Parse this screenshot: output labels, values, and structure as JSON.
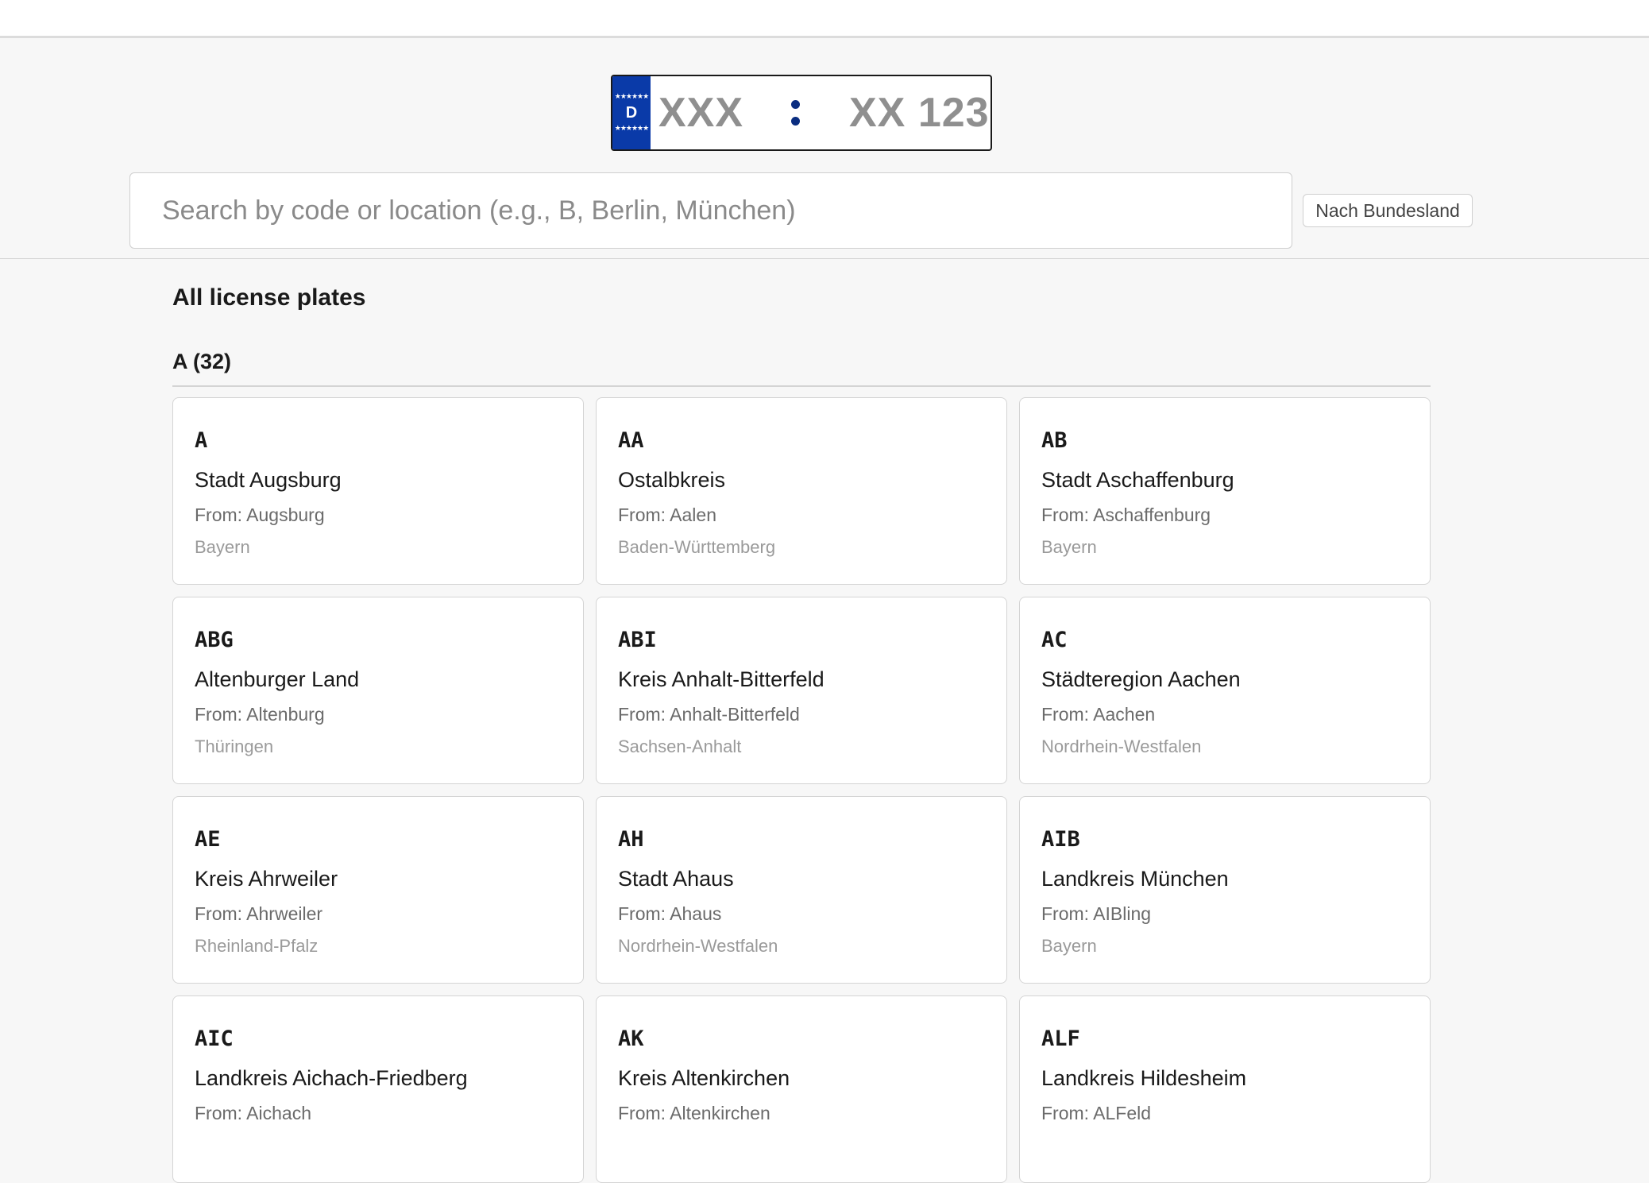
{
  "plate": {
    "eu_stars_top": "★★★★★★",
    "country": "D",
    "eu_stars_bottom": "★★★★★★",
    "left_placeholder": "XXX",
    "right_placeholder": "XX 123"
  },
  "search": {
    "placeholder": "Search by code or location (e.g., B, Berlin, München)",
    "value": ""
  },
  "filter_button": "Nach Bundesland",
  "page_title": "All license plates",
  "group": {
    "title": "A (32)",
    "cards": [
      {
        "code": "A",
        "name": "Stadt Augsburg",
        "from": "From: Augsburg",
        "state": "Bayern"
      },
      {
        "code": "AA",
        "name": "Ostalbkreis",
        "from": "From: Aalen",
        "state": "Baden-Württemberg"
      },
      {
        "code": "AB",
        "name": "Stadt Aschaffenburg",
        "from": "From: Aschaffenburg",
        "state": "Bayern"
      },
      {
        "code": "ABG",
        "name": "Altenburger Land",
        "from": "From: Altenburg",
        "state": "Thüringen"
      },
      {
        "code": "ABI",
        "name": "Kreis Anhalt-Bitterfeld",
        "from": "From: Anhalt-Bitterfeld",
        "state": "Sachsen-Anhalt"
      },
      {
        "code": "AC",
        "name": "Städteregion Aachen",
        "from": "From: Aachen",
        "state": "Nordrhein-Westfalen"
      },
      {
        "code": "AE",
        "name": "Kreis Ahrweiler",
        "from": "From: Ahrweiler",
        "state": "Rheinland-Pfalz"
      },
      {
        "code": "AH",
        "name": "Stadt Ahaus",
        "from": "From: Ahaus",
        "state": "Nordrhein-Westfalen"
      },
      {
        "code": "AIB",
        "name": "Landkreis München",
        "from": "From: AIBling",
        "state": "Bayern"
      },
      {
        "code": "AIC",
        "name": "Landkreis Aichach-Friedberg",
        "from": "From: Aichach",
        "state": ""
      },
      {
        "code": "AK",
        "name": "Kreis Altenkirchen",
        "from": "From: Altenkirchen",
        "state": ""
      },
      {
        "code": "ALF",
        "name": "Landkreis Hildesheim",
        "from": "From: ALFeld",
        "state": ""
      }
    ]
  }
}
